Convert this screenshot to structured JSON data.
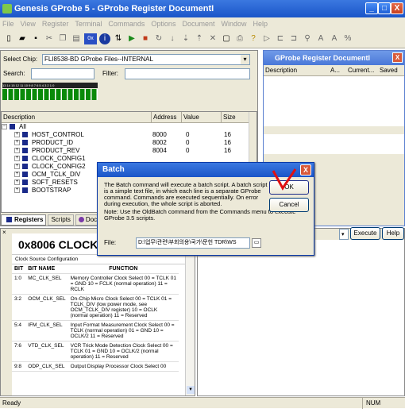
{
  "window": {
    "title": "Genesis GProbe 5 - GProbe Register DocumentI",
    "min_label": "_",
    "max_label": "□",
    "close_label": "X"
  },
  "menu": [
    "File",
    "View",
    "Register",
    "Terminal",
    "Commands",
    "Options",
    "Document",
    "Window",
    "Help"
  ],
  "left": {
    "select_chip_label": "Select Chip:",
    "select_chip_value": "FLI8538-BD GProbe Files--INTERNAL",
    "search_label": "Search:",
    "filter_label": "Filter:",
    "bits_header": "13 14 15 12 11 10 9  8  7  6  5  4  3  2  1  0",
    "columns": {
      "description": "Description",
      "address": "Address",
      "value": "Value",
      "size": "Size"
    },
    "rows": [
      {
        "name": "All",
        "address": "",
        "value": "",
        "size": ""
      },
      {
        "name": "HOST_CONTROL",
        "address": "8000",
        "value": "0",
        "size": "16"
      },
      {
        "name": "PRODUCT_ID",
        "address": "8002",
        "value": "0",
        "size": "16"
      },
      {
        "name": "PRODUCT_REV",
        "address": "8004",
        "value": "0",
        "size": "16"
      },
      {
        "name": "CLOCK_CONFIG1",
        "address": "",
        "value": "",
        "size": ""
      },
      {
        "name": "CLOCK_CONFIG2",
        "address": "",
        "value": "",
        "size": ""
      },
      {
        "name": "OCM_TCLK_DIV",
        "address": "",
        "value": "",
        "size": ""
      },
      {
        "name": "SOFT_RESETS",
        "address": "",
        "value": "",
        "size": ""
      },
      {
        "name": "BOOTSTRAP",
        "address": "",
        "value": "",
        "size": ""
      }
    ],
    "tabs": [
      "Registers",
      "Scripts",
      "Doc"
    ]
  },
  "doc_window": {
    "title": "GProbe Register DocumentI",
    "columns": [
      "Description",
      "A...",
      "Current...",
      "Saved"
    ]
  },
  "register_doc": {
    "heading": "0x8006  CLOCK_C",
    "subheading": "Clock Source Configuration",
    "table_headers": [
      "BIT",
      "BIT NAME",
      "FUNCTION"
    ],
    "rows": [
      {
        "bit": "1:0",
        "name": "MC_CLK_SEL",
        "func": "Memory Controller Clock Select 00 = TCLK 01 = GND 10 = FCLK (normal operation) 11 = RCLK"
      },
      {
        "bit": "3:2",
        "name": "OCM_CLK_SEL",
        "func": "On-Chip Micro Clock Select 00 = TCLK 01 = TCLK_DIV (low power mode, see OCM_TCLK_DIV register) 10 = OCLK (normal operation) 11 = Reserved"
      },
      {
        "bit": "5:4",
        "name": "IFM_CLK_SEL",
        "func": "Input Format Measurement Clock Select 00 = TCLK (normal operation) 01 = GND 10 = OCLK/2 11 = Reserved"
      },
      {
        "bit": "7:6",
        "name": "VTD_CLK_SEL",
        "func": "VCR Trick Mode Detection Clock Select 00 = TCLK 01 = GND 10 = OCLK/2 (normal operation) 11 = Reserved"
      },
      {
        "bit": "9:8",
        "name": "ODP_CLK_SEL",
        "func": "Output Display Processor Clock Select 00"
      }
    ]
  },
  "right_bottom": {
    "execute_label": "Execute",
    "help_label": "Help"
  },
  "dialog": {
    "title": "Batch",
    "message": "The Batch command will execute a batch script. A batch script is a simple text file, in which each line is a separate GProbe command. Commands are executed sequentially. On error during execution, the whole script is aborted.",
    "note": "Note: Use the OldBatch command from the Commands menu to execute GProbe 3.5 scripts.",
    "file_label": "File:",
    "file_value": "D:\\업무\\관련\\부회의용\\국가\\문헌 TDR\\WS",
    "ok_label": "OK",
    "cancel_label": "Cancel"
  },
  "status": {
    "left": "Ready",
    "num": "NUM"
  },
  "colors": {
    "title_bar": "#1a55c8",
    "dialog_title": "#1a55c8",
    "green_bits": "#0a8a0a",
    "annotation_red": "#e01010"
  }
}
